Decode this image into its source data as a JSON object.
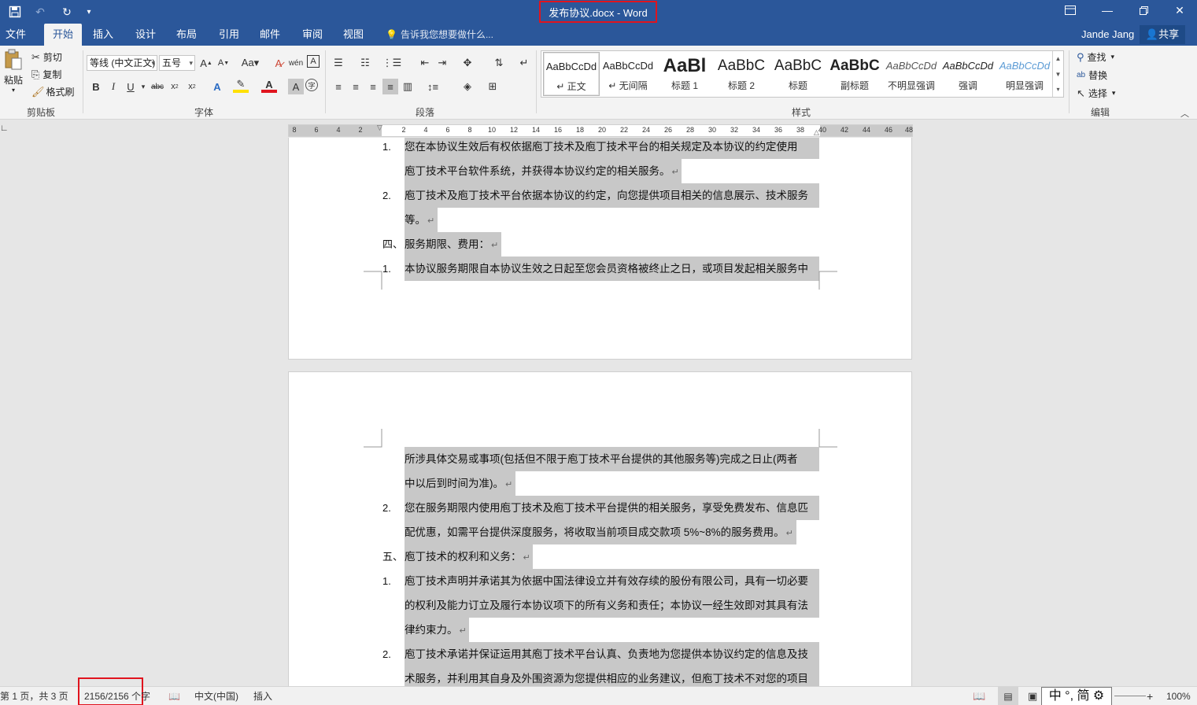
{
  "window": {
    "title": "发布协议.docx - Word",
    "controls": [
      "ribbon-display-icon",
      "minimize-icon",
      "restore-icon",
      "close-icon"
    ]
  },
  "quick_access": [
    "save-icon",
    "undo-icon",
    "redo-icon",
    "customize-icon"
  ],
  "tabs": [
    {
      "label": "文件",
      "active": false
    },
    {
      "label": "开始",
      "active": true
    },
    {
      "label": "插入",
      "active": false
    },
    {
      "label": "设计",
      "active": false
    },
    {
      "label": "布局",
      "active": false
    },
    {
      "label": "引用",
      "active": false
    },
    {
      "label": "邮件",
      "active": false
    },
    {
      "label": "审阅",
      "active": false
    },
    {
      "label": "视图",
      "active": false
    }
  ],
  "tell_me": "告诉我您想要做什么...",
  "user": "Jande Jang",
  "share": "共享",
  "ribbon": {
    "clipboard": {
      "paste": "粘贴",
      "cut": "剪切",
      "copy": "复制",
      "format_painter": "格式刷",
      "label": "剪贴板"
    },
    "font": {
      "name": "等线 (中文正文)",
      "size": "五号",
      "label": "字体"
    },
    "paragraph": {
      "label": "段落"
    },
    "styles": {
      "label": "样式",
      "items": [
        {
          "preview": "AaBbCcDd",
          "name": "↵ 正文"
        },
        {
          "preview": "AaBbCcDd",
          "name": "↵ 无间隔"
        },
        {
          "preview": "AaBl",
          "name": "标题 1"
        },
        {
          "preview": "AaBbC",
          "name": "标题 2"
        },
        {
          "preview": "AaBbC",
          "name": "标题"
        },
        {
          "preview": "AaBbC",
          "name": "副标题"
        },
        {
          "preview": "AaBbCcDd",
          "name": "不明显强调"
        },
        {
          "preview": "AaBbCcDd",
          "name": "强调"
        },
        {
          "preview": "AaBbCcDd",
          "name": "明显强调"
        }
      ]
    },
    "editing": {
      "find": "查找",
      "replace": "替换",
      "select": "选择",
      "label": "编辑"
    }
  },
  "ruler_ticks": [
    "8",
    "6",
    "4",
    "2",
    "",
    "2",
    "4",
    "6",
    "8",
    "10",
    "12",
    "14",
    "16",
    "18",
    "20",
    "22",
    "24",
    "26",
    "28",
    "30",
    "32",
    "34",
    "36",
    "38",
    "40",
    "42",
    "44",
    "46",
    "48"
  ],
  "page1": {
    "lines": [
      {
        "num": "1.",
        "text": "您在本协议生效后有权依据庖丁技术及庖丁技术平台的相关规定及本协议的约定使用"
      },
      {
        "num": "",
        "text": "庖丁技术平台软件系统，并获得本协议约定的相关服务。"
      },
      {
        "num": "2.",
        "text": "庖丁技术及庖丁技术平台依据本协议的约定，向您提供项目相关的信息展示、技术服务"
      },
      {
        "num": "",
        "text": "等。"
      },
      {
        "num": "四、",
        "text": "服务期限、费用："
      },
      {
        "num": "1.",
        "text": "本协议服务期限自本协议生效之日起至您会员资格被终止之日，或项目发起相关服务中"
      }
    ]
  },
  "page2": {
    "lines": [
      {
        "num": "",
        "text": "所涉具体交易或事项(包括但不限于庖丁技术平台提供的其他服务等)完成之日止(两者"
      },
      {
        "num": "",
        "text": "中以后到时间为准)。"
      },
      {
        "num": "2.",
        "text": "您在服务期限内使用庖丁技术及庖丁技术平台提供的相关服务，享受免费发布、信息匹"
      },
      {
        "num": "",
        "text": "配优惠，如需平台提供深度服务，将收取当前项目成交款项 5%~8%的服务费用。"
      },
      {
        "num": "五、",
        "text": "庖丁技术的权利和义务："
      },
      {
        "num": "1.",
        "text": "庖丁技术声明并承诺其为依据中国法律设立并有效存续的股份有限公司，具有一切必要"
      },
      {
        "num": "",
        "text": "的权利及能力订立及履行本协议项下的所有义务和责任；本协议一经生效即对其具有法"
      },
      {
        "num": "",
        "text": "律约束力。"
      },
      {
        "num": "2.",
        "text": "庖丁技术承诺并保证运用其庖丁技术平台认真、负责地为您提供本协议约定的信息及技"
      },
      {
        "num": "",
        "text": "术服务，并利用其自身及外围资源为您提供相应的业务建议，但庖丁技术不对您的项目"
      }
    ]
  },
  "paragraph_mark": "↵",
  "status": {
    "page": "第 1 页，共 3 页",
    "words": "2156/2156 个字",
    "language": "中文(中国)",
    "mode": "插入",
    "ime": "中 °, 简",
    "zoom": "100%"
  },
  "colors": {
    "title_bar": "#2b579a",
    "highlight": "#c8c8c8",
    "annotation_box": "#e0141e"
  }
}
